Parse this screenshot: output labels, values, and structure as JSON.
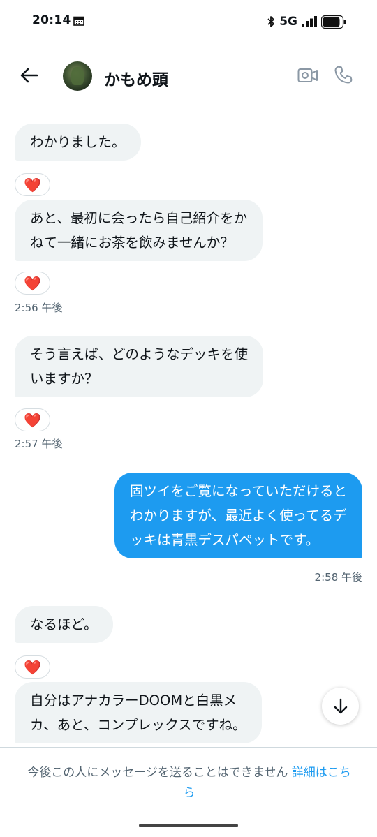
{
  "status_bar": {
    "time": "20:14",
    "network": "5G",
    "icons": [
      "calendar-icon",
      "bluetooth-icon",
      "signal-icon",
      "battery-icon"
    ]
  },
  "header": {
    "back_icon": "arrow-left-icon",
    "contact_name": "かもめ頭",
    "video_icon": "video-call-icon",
    "call_icon": "phone-icon"
  },
  "messages": [
    {
      "direction": "received",
      "text": "わかりました。",
      "reaction": "❤️"
    },
    {
      "direction": "received",
      "lines": [
        "あと、最初に会ったら自己紹介をか",
        "ねて一緒にお茶を飲みませんか？"
      ],
      "reaction": "❤️",
      "timestamp": "2:56 午後"
    },
    {
      "direction": "received",
      "lines": [
        "そう言えば、どのようなデッキを使",
        "いますか？"
      ],
      "reaction": "❤️",
      "timestamp": "2:57 午後"
    },
    {
      "direction": "sent",
      "lines": [
        "固ツイをご覧になっていただけると",
        "わかりますが、最近よく使ってるデ",
        "ッキは青黒デスパペットです。"
      ],
      "timestamp": "2:58 午後"
    },
    {
      "direction": "received",
      "text": "なるほど。",
      "reaction": "❤️"
    },
    {
      "direction": "received",
      "lines": [
        "自分はアナカラーDOOMと白黒メ",
        "カ、あと、コンプレックスですね。"
      ]
    }
  ],
  "scroll_button_icon": "arrow-down-icon",
  "footer": {
    "notice": "今後この人にメッセージを送ることはできません",
    "link_line1": "詳細はこち",
    "link_line2": "ら"
  },
  "colors": {
    "sent_bubble": "#1d9bf0",
    "received_bubble": "#eff3f4",
    "link": "#1d9bf0",
    "muted_text": "#536471",
    "heart": "#e8334a"
  }
}
